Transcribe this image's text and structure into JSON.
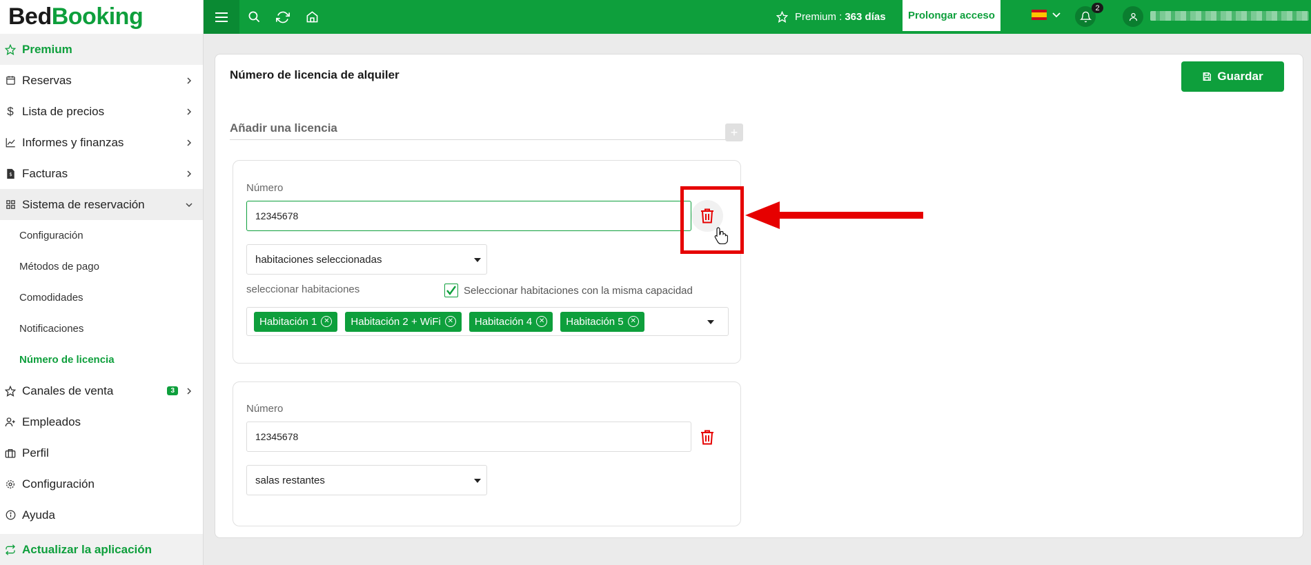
{
  "logo": {
    "part1": "Bed",
    "part2": "Booking"
  },
  "sidebar": {
    "premium": "Premium",
    "items": [
      {
        "label": "Reservas",
        "icon": "calendar-icon"
      },
      {
        "label": "Lista de precios",
        "icon": "dollar-icon"
      },
      {
        "label": "Informes y finanzas",
        "icon": "chart-icon"
      },
      {
        "label": "Facturas",
        "icon": "invoice-icon"
      },
      {
        "label": "Sistema de reservación",
        "icon": "grid-icon"
      }
    ],
    "sub_items": [
      "Configuración",
      "Métodos de pago",
      "Comodidades",
      "Notificaciones",
      "Número de licencia"
    ],
    "items_after": [
      {
        "label": "Canales de venta",
        "icon": "star-icon",
        "badge": "3"
      },
      {
        "label": "Empleados",
        "icon": "user-plus-icon"
      },
      {
        "label": "Perfil",
        "icon": "briefcase-icon"
      },
      {
        "label": "Configuración",
        "icon": "gear-icon"
      },
      {
        "label": "Ayuda",
        "icon": "info-icon"
      }
    ],
    "update": "Actualizar la aplicación"
  },
  "topbar": {
    "premium_label": "Premium :",
    "premium_days": "363 días",
    "prolongar": "Prolongar acceso",
    "notifications": "2"
  },
  "main": {
    "title": "Número de licencia de alquiler",
    "save": "Guardar",
    "add_license": "Añadir una licencia",
    "licenses": [
      {
        "number_label": "Número",
        "number_value": "12345678",
        "scope": "habitaciones seleccionadas",
        "select_rooms_label": "seleccionar habitaciones",
        "same_capacity_label": "Seleccionar habitaciones con la misma capacidad",
        "rooms": [
          "Habitación 1",
          "Habitación 2 + WiFi",
          "Habitación 4",
          "Habitación 5"
        ]
      },
      {
        "number_label": "Número",
        "number_value": "12345678",
        "scope": "salas restantes"
      }
    ]
  },
  "colors": {
    "brand": "#0e9f3c",
    "highlight": "#e60000"
  }
}
